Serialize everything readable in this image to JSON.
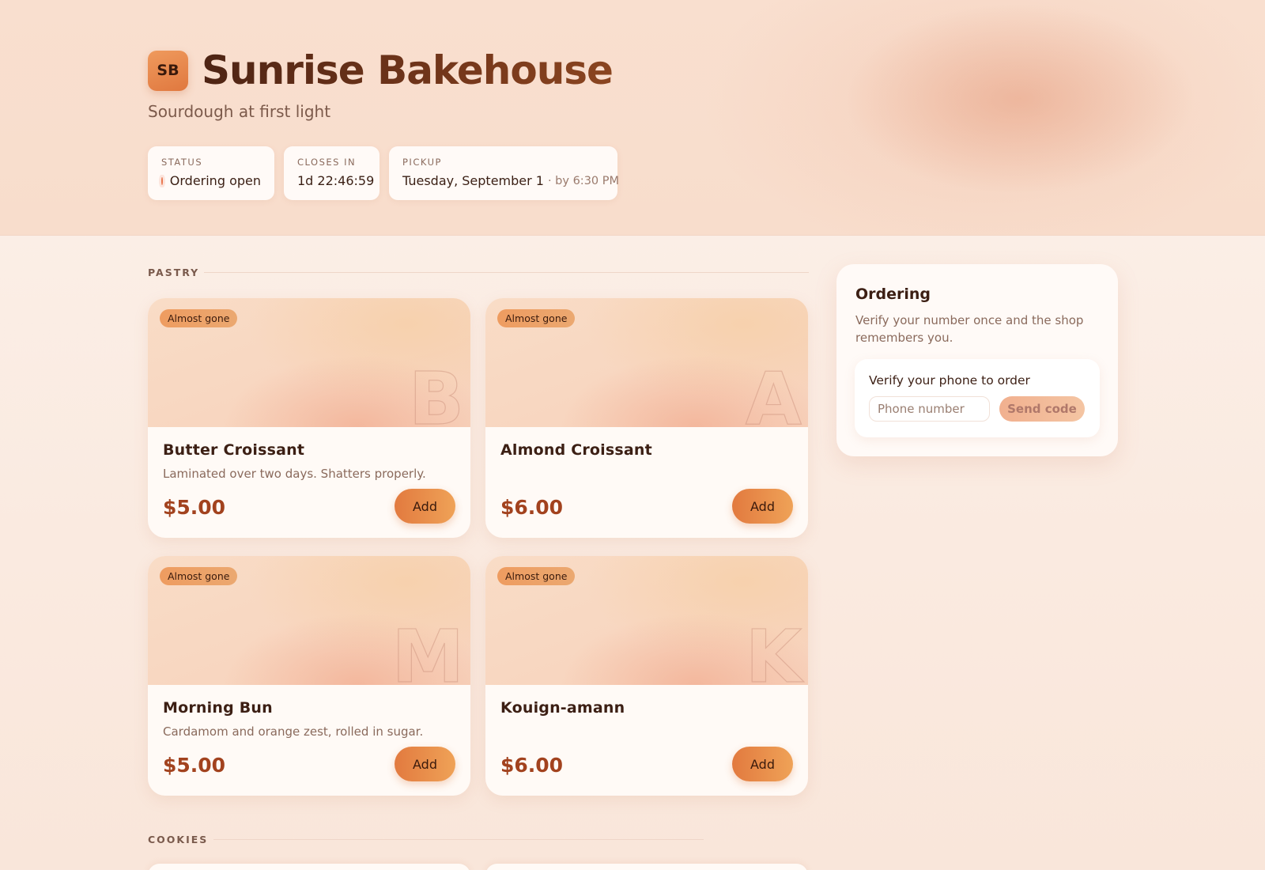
{
  "shop": {
    "logo_initials": "SB",
    "name": "Sunrise Bakehouse",
    "tagline": "Sourdough at first light"
  },
  "stats": {
    "status": {
      "label": "STATUS",
      "value": "Ordering open"
    },
    "closes": {
      "label": "CLOSES IN",
      "value": "1d 22:46:59"
    },
    "pickup": {
      "label": "PICKUP",
      "value": "Tuesday, September 1",
      "suffix": "· by 6:30 PM"
    }
  },
  "sections": {
    "pastry": "PASTRY",
    "cookies": "COOKIES"
  },
  "products": [
    {
      "badge": "Almost gone",
      "letter": "B",
      "name": "Butter Croissant",
      "desc": "Laminated over two days. Shatters properly.",
      "price": "$5.00",
      "add": "Add"
    },
    {
      "badge": "Almost gone",
      "letter": "A",
      "name": "Almond Croissant",
      "desc": "",
      "price": "$6.00",
      "add": "Add"
    },
    {
      "badge": "Almost gone",
      "letter": "M",
      "name": "Morning Bun",
      "desc": "Cardamom and orange zest, rolled in sugar.",
      "price": "$5.00",
      "add": "Add"
    },
    {
      "badge": "Almost gone",
      "letter": "K",
      "name": "Kouign-amann",
      "desc": "",
      "price": "$6.00",
      "add": "Add"
    }
  ],
  "ordering": {
    "title": "Ordering",
    "desc": "Verify your number once and the shop remembers you.",
    "verify_title": "Verify your phone to order",
    "phone_placeholder": "Phone number",
    "send_label": "Send code"
  },
  "colors": {
    "accent": "#e27a3f",
    "price": "#a2421e",
    "status_dot": "#e9734a"
  }
}
